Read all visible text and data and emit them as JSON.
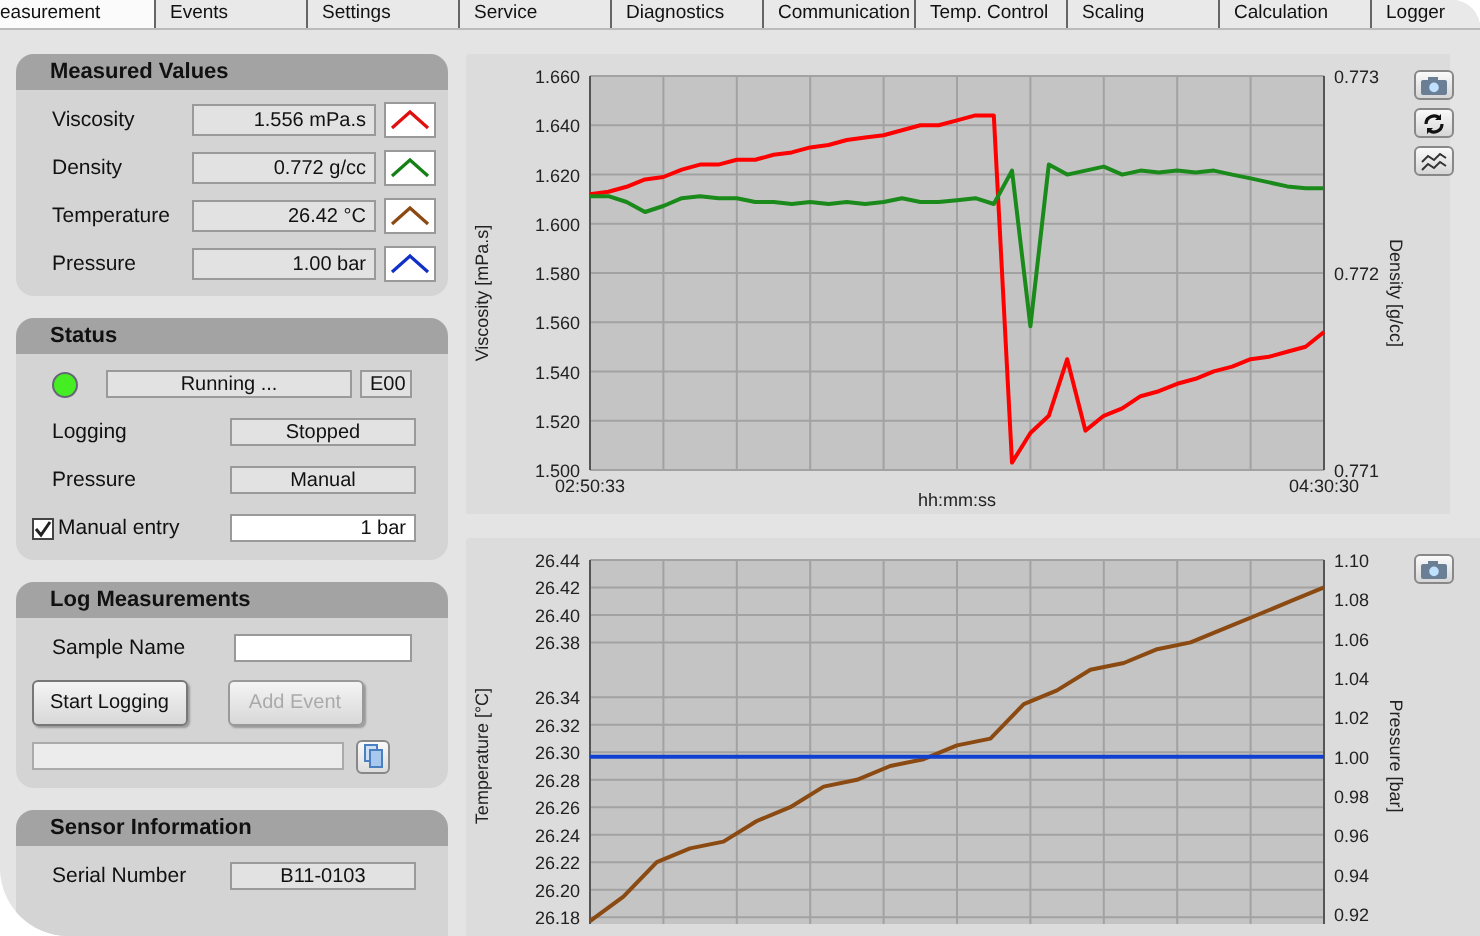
{
  "tabs": [
    {
      "label": "easurement",
      "selected": true
    },
    {
      "label": "Events",
      "selected": false
    },
    {
      "label": "Settings",
      "selected": false
    },
    {
      "label": "Service",
      "selected": false
    },
    {
      "label": "Diagnostics",
      "selected": false
    },
    {
      "label": "Communication",
      "selected": false
    },
    {
      "label": "Temp. Control",
      "selected": false
    },
    {
      "label": "Scaling",
      "selected": false
    },
    {
      "label": "Calculation",
      "selected": false
    },
    {
      "label": "Logger",
      "selected": false
    }
  ],
  "measured_values": {
    "title": "Measured Values",
    "rows": [
      {
        "label": "Viscosity",
        "value": "1.556 mPa.s",
        "color": "#e01010"
      },
      {
        "label": "Density",
        "value": "0.772 g/cc",
        "color": "#158015"
      },
      {
        "label": "Temperature",
        "value": "26.42 °C",
        "color": "#8b4a12"
      },
      {
        "label": "Pressure",
        "value": "1.00 bar",
        "color": "#1030c8"
      }
    ]
  },
  "status": {
    "title": "Status",
    "indicator_on": true,
    "state": "Running ...",
    "code": "E00",
    "rows": [
      {
        "kind": "display",
        "label": "Logging",
        "value": "Stopped"
      },
      {
        "kind": "display",
        "label": "Pressure",
        "value": "Manual"
      },
      {
        "kind": "checkbox",
        "label": "Manual entry",
        "checked": true,
        "value": "1 bar"
      }
    ]
  },
  "log_measurements": {
    "title": "Log Measurements",
    "sample_name_label": "Sample Name",
    "buttons": [
      {
        "label": "Start Logging",
        "disabled": false
      },
      {
        "label": "Add Event",
        "disabled": true
      }
    ]
  },
  "sensor_information": {
    "title": "Sensor Information",
    "rows": [
      {
        "label": "Serial Number",
        "value": "B11-0103"
      }
    ]
  },
  "viscosity_density_chart": {
    "chart_data": {
      "type": "line",
      "grid": true,
      "xlabel": "hh:mm:ss",
      "ylabel": "Viscosity [mPa.s]",
      "y2label": "Density [g/cc]",
      "categories": [
        "02:50:33",
        null,
        null,
        null,
        null,
        null,
        null,
        null,
        null,
        null,
        null,
        null,
        null,
        null,
        null,
        null,
        null,
        null,
        null,
        null,
        null,
        null,
        null,
        null,
        null,
        null,
        null,
        null,
        null,
        null,
        null,
        null,
        null,
        null,
        null,
        null,
        null,
        null,
        null,
        null,
        "04:30:30"
      ],
      "ylim": [
        1.5,
        1.66
      ],
      "yticks": [
        {
          "value": 1.5,
          "label": "1.500"
        },
        {
          "value": 1.52,
          "label": "1.520"
        },
        {
          "value": 1.54,
          "label": "1.540"
        },
        {
          "value": 1.56,
          "label": "1.560"
        },
        {
          "value": 1.58,
          "label": "1.580"
        },
        {
          "value": 1.6,
          "label": "1.600"
        },
        {
          "value": 1.62,
          "label": "1.620"
        },
        {
          "value": 1.64,
          "label": "1.640"
        },
        {
          "value": 1.66,
          "label": "1.660"
        }
      ],
      "y2lim": [
        0.771,
        0.773
      ],
      "y2ticks": [
        {
          "value": 0.771,
          "label": "0.771"
        },
        {
          "value": 0.772,
          "label": "0.772"
        },
        {
          "value": 0.773,
          "label": "0.773"
        }
      ],
      "series": [
        {
          "color": "#ff0000",
          "values": [
            1.612,
            1.613,
            1.615,
            1.618,
            1.619,
            1.622,
            1.624,
            1.624,
            1.626,
            1.626,
            1.628,
            1.629,
            1.631,
            1.632,
            1.634,
            1.635,
            1.636,
            1.638,
            1.64,
            1.64,
            1.642,
            1.644,
            1.644,
            1.503,
            1.515,
            1.522,
            1.545,
            1.516,
            1.522,
            1.525,
            1.53,
            1.532,
            1.535,
            1.537,
            1.54,
            1.542,
            1.545,
            1.546,
            1.548,
            1.55,
            1.556
          ]
        },
        {
          "color": "#1a8a1a",
          "axis": "y2",
          "values": [
            0.77239,
            0.77239,
            0.77236,
            0.77231,
            0.77234,
            0.77238,
            0.77239,
            0.77238,
            0.77238,
            0.77236,
            0.77236,
            0.77235,
            0.77236,
            0.77235,
            0.77236,
            0.77235,
            0.77236,
            0.77238,
            0.77236,
            0.77236,
            0.77237,
            0.77238,
            0.77235,
            0.77252,
            0.77173,
            0.77255,
            0.7725,
            0.77252,
            0.77254,
            0.7725,
            0.77252,
            0.77251,
            0.77252,
            0.77251,
            0.77252,
            0.7725,
            0.77248,
            0.77246,
            0.77244,
            0.77243,
            0.77243
          ]
        }
      ]
    }
  },
  "temperature_pressure_chart": {
    "chart_data": {
      "type": "line",
      "grid": true,
      "ylabel": "Temperature [°C]",
      "y2label": "Pressure [bar]",
      "categories": [
        null,
        null,
        null,
        null,
        null,
        null,
        null,
        null,
        null,
        null,
        null,
        null,
        null,
        null,
        null,
        null,
        null,
        null,
        null,
        null,
        null,
        null,
        null
      ],
      "ylim": [
        26.175,
        26.44
      ],
      "yticks": [
        {
          "value": 26.18,
          "label": "26.18"
        },
        {
          "value": 26.2,
          "label": "26.20"
        },
        {
          "value": 26.22,
          "label": "26.22"
        },
        {
          "value": 26.24,
          "label": "26.24"
        },
        {
          "value": 26.26,
          "label": "26.26"
        },
        {
          "value": 26.28,
          "label": "26.28"
        },
        {
          "value": 26.3,
          "label": "26.30"
        },
        {
          "value": 26.32,
          "label": "26.32"
        },
        {
          "value": 26.34,
          "label": "26.34"
        },
        {
          "value": 26.38,
          "label": "26.38"
        },
        {
          "value": 26.4,
          "label": "26.40"
        },
        {
          "value": 26.42,
          "label": "26.42"
        },
        {
          "value": 26.44,
          "label": "26.44"
        }
      ],
      "y2lim": [
        0.915,
        1.1
      ],
      "y2ticks": [
        {
          "value": 0.92,
          "label": "0.92"
        },
        {
          "value": 0.94,
          "label": "0.94"
        },
        {
          "value": 0.96,
          "label": "0.96"
        },
        {
          "value": 0.98,
          "label": "0.98"
        },
        {
          "value": 1.0,
          "label": "1.00"
        },
        {
          "value": 1.02,
          "label": "1.02"
        },
        {
          "value": 1.04,
          "label": "1.04"
        },
        {
          "value": 1.06,
          "label": "1.06"
        },
        {
          "value": 1.08,
          "label": "1.08"
        },
        {
          "value": 1.1,
          "label": "1.10"
        }
      ],
      "series": [
        {
          "color": "#8b4a12",
          "values": [
            26.177,
            26.195,
            26.22,
            26.23,
            26.235,
            26.25,
            26.26,
            26.275,
            26.28,
            26.29,
            26.295,
            26.305,
            26.31,
            26.335,
            26.345,
            26.36,
            26.365,
            26.375,
            26.38,
            26.39,
            26.4,
            26.41,
            26.42
          ]
        },
        {
          "color": "#1040d0",
          "axis": "y2",
          "values": [
            1.0,
            1.0,
            1.0,
            1.0,
            1.0,
            1.0,
            1.0,
            1.0,
            1.0,
            1.0,
            1.0,
            1.0,
            1.0,
            1.0,
            1.0,
            1.0,
            1.0,
            1.0,
            1.0,
            1.0,
            1.0,
            1.0,
            1.0
          ]
        }
      ]
    }
  }
}
